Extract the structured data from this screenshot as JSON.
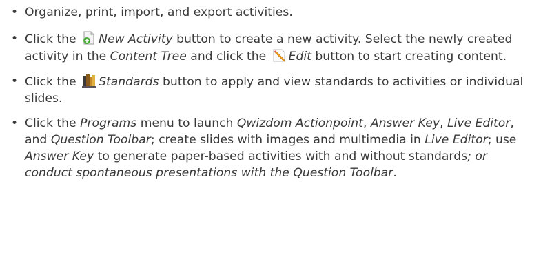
{
  "bullet_glyph": "•",
  "bullets": [
    {
      "text": "Organize, print, import, and export activities."
    },
    {
      "t1": "Click the ",
      "new_activity": "New Activity",
      "t2": " button to create a new activity. Select the newly created activity in the ",
      "content_tree": "Content Tree",
      "t3": " and click the ",
      "edit": "Edit",
      "t4": " button to start creating content."
    },
    {
      "t1": "Click the ",
      "standards": "Standards",
      "t2": " button to apply and view standards to activities or individual slides."
    },
    {
      "t1": "Click the ",
      "programs": "Programs",
      "t2": " menu to launch ",
      "actionpoint": "Qwizdom Actionpoint",
      "t3": ", ",
      "answer_key": "Answer Key",
      "t4": ", ",
      "live_editor": "Live Editor",
      "t5": ", and ",
      "question_toolbar": "Question Toolbar",
      "t6": "; create slides with images and multimedia in ",
      "live_editor_2": "Live Editor",
      "t7": "; use ",
      "answer_key_2": "Answer Key",
      "t8": " to generate paper-based activities with and without standards",
      "t9": "; or conduct spontaneous presentations with the ",
      "question_toolbar_2": "Question Toolbar",
      "t10": "."
    }
  ],
  "icons": {
    "new_activity": "new-activity-icon",
    "edit": "edit-pencil-icon",
    "standards": "standards-books-icon"
  },
  "colors": {
    "text": "#3a3a3a",
    "new_activity_green": "#4caf3c",
    "edit_orange": "#f0a020",
    "standards_brown": "#8a5a1a"
  }
}
